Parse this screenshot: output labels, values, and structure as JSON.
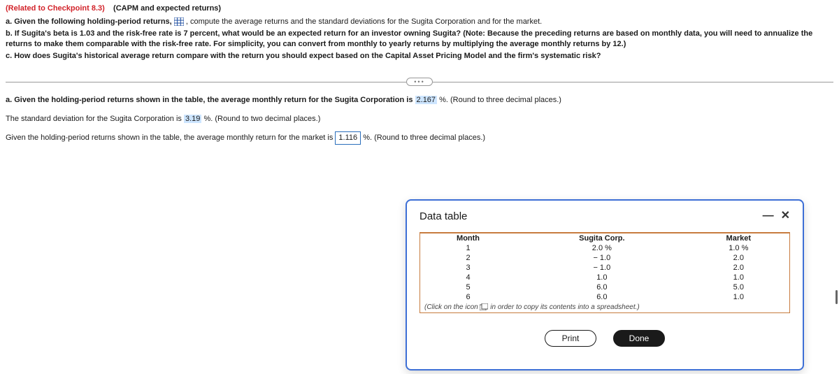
{
  "header": {
    "checkpoint": "(Related to Checkpoint 8.3)",
    "subtitle": "(CAPM and expected returns)"
  },
  "questions": {
    "a_prefix": "a.  Given the following holding-period returns, ",
    "a_suffix": ", compute the average returns and the standard deviations for the Sugita Corporation and for the market.",
    "b": "b.  If Sugita's beta is 1.03 and the risk-free rate is 7 percent, what would be an expected return for an investor owning Sugita?  (Note:  Because the preceding returns are based on monthly data, you will need to annualize the returns to make them comparable with the risk-free rate.  For simplicity, you can convert from monthly to yearly returns by multiplying the average monthly returns by 12.)",
    "c": "c.  How does Sugita's historical average return compare with the return you should expect based on the Capital Asset Pricing Model and the firm's systematic risk?"
  },
  "answers": {
    "line1_pre": "a.  Given the holding-period returns shown in the table, the average monthly return for the Sugita Corporation is ",
    "val1": "2.167",
    "line1_post": " %.  (Round to three decimal places.)",
    "line2_pre": "The standard deviation for the Sugita Corporation is ",
    "val2": "3.19",
    "line2_post": " %.  (Round to two decimal places.)",
    "line3_pre": "Given the holding-period returns shown in the table, the average monthly return for the market is ",
    "val3": "1.116",
    "line3_post": " %.  (Round to three decimal places.)"
  },
  "modal": {
    "title": "Data table",
    "headers": {
      "c1": "Month",
      "c2": "Sugita Corp.",
      "c3": "Market"
    },
    "rows": [
      {
        "m": "1",
        "s": "2.0 %",
        "k": "1.0 %"
      },
      {
        "m": "2",
        "s": "− 1.0",
        "k": "2.0"
      },
      {
        "m": "3",
        "s": "− 1.0",
        "k": "2.0"
      },
      {
        "m": "4",
        "s": "1.0",
        "k": "1.0"
      },
      {
        "m": "5",
        "s": "6.0",
        "k": "5.0"
      },
      {
        "m": "6",
        "s": "6.0",
        "k": "1.0"
      }
    ],
    "note_pre": "(Click on the icon ",
    "note_post": "  in order to copy its contents into a spreadsheet.)",
    "print": "Print",
    "done": "Done"
  },
  "chart_data": {
    "type": "table",
    "title": "Data table",
    "columns": [
      "Month",
      "Sugita Corp.",
      "Market"
    ],
    "rows": [
      [
        1,
        2.0,
        1.0
      ],
      [
        2,
        -1.0,
        2.0
      ],
      [
        3,
        -1.0,
        2.0
      ],
      [
        4,
        1.0,
        1.0
      ],
      [
        5,
        6.0,
        5.0
      ],
      [
        6,
        6.0,
        1.0
      ]
    ],
    "units": "percent"
  }
}
